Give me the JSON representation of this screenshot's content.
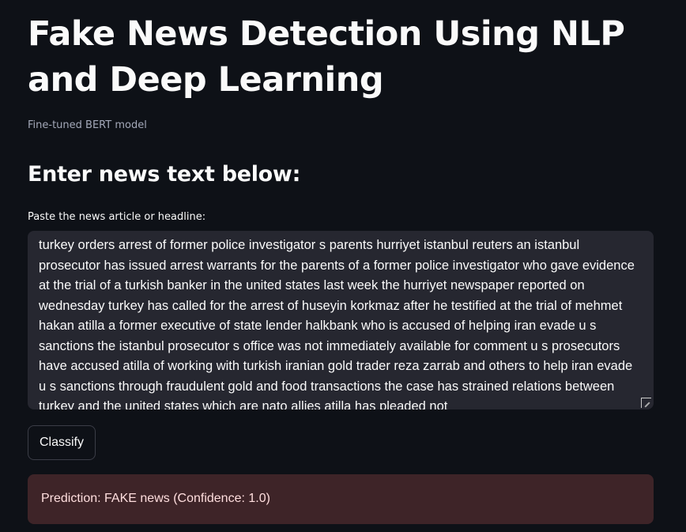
{
  "page": {
    "title": "Fake News Detection Using NLP and Deep Learning",
    "subtitle": "Fine-tuned BERT model",
    "section_heading": "Enter news text below:"
  },
  "input": {
    "label": "Paste the news article or headline:",
    "value": "turkey orders arrest of former police investigator s parents hurriyet istanbul reuters an istanbul prosecutor has issued arrest warrants for the parents of a former police investigator who gave evidence at the trial of a turkish banker in the united states last week the hurriyet newspaper reported on wednesday turkey has called for the arrest of huseyin korkmaz after he testified at the trial of mehmet hakan atilla a former executive of state lender halkbank who is accused of helping iran evade u s sanctions the istanbul prosecutor s office was not immediately available for comment u s prosecutors have accused atilla of working with turkish iranian gold trader reza zarrab and others to help iran evade u s sanctions through fraudulent gold and food transactions the case has strained relations between turkey and the united states which are nato allies atilla has pleaded not"
  },
  "actions": {
    "classify_label": "Classify"
  },
  "result": {
    "text": "Prediction: FAKE news (Confidence: 1.0)",
    "color": "#3e2428"
  }
}
